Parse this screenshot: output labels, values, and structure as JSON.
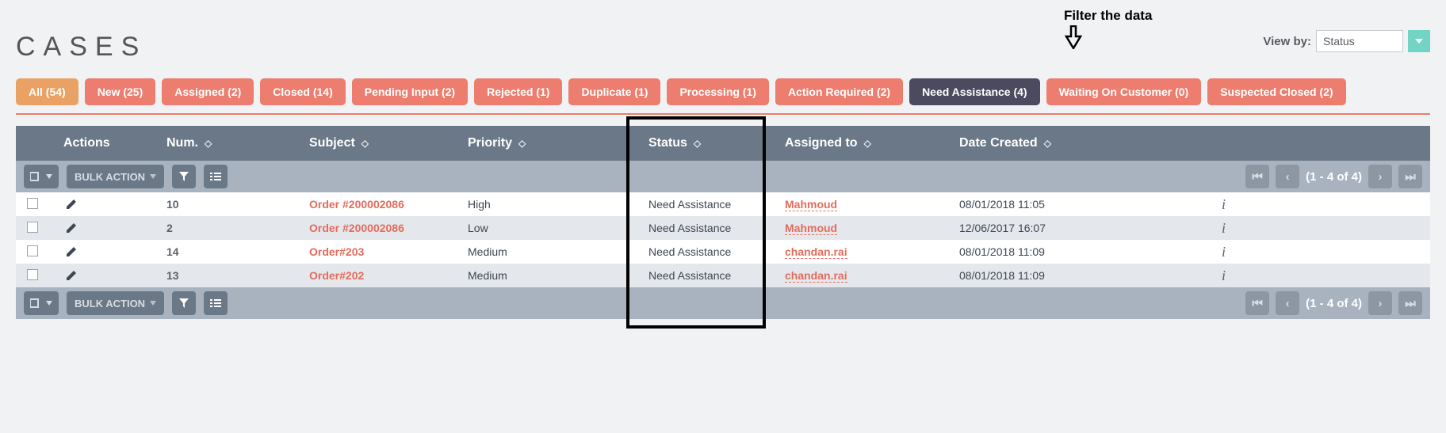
{
  "annotation": "Filter the data",
  "title": "CASES",
  "viewby": {
    "label": "View by:",
    "value": "Status"
  },
  "filters": [
    {
      "label": "All (54)",
      "style": "orange"
    },
    {
      "label": "New (25)",
      "style": ""
    },
    {
      "label": "Assigned (2)",
      "style": ""
    },
    {
      "label": "Closed (14)",
      "style": ""
    },
    {
      "label": "Pending Input (2)",
      "style": ""
    },
    {
      "label": "Rejected (1)",
      "style": ""
    },
    {
      "label": "Duplicate (1)",
      "style": ""
    },
    {
      "label": "Processing (1)",
      "style": ""
    },
    {
      "label": "Action Required (2)",
      "style": ""
    },
    {
      "label": "Need Assistance (4)",
      "style": "dark"
    },
    {
      "label": "Waiting On Customer (0)",
      "style": ""
    },
    {
      "label": "Suspected Closed (2)",
      "style": ""
    }
  ],
  "columns": {
    "actions": "Actions",
    "num": "Num.",
    "subject": "Subject",
    "priority": "Priority",
    "status": "Status",
    "assigned": "Assigned to",
    "date": "Date Created"
  },
  "bulk": "BULK ACTION",
  "pagination": "(1 - 4 of 4)",
  "rows": [
    {
      "num": "10",
      "subject": "Order #200002086",
      "priority": "High",
      "status": "Need Assistance",
      "assigned": "Mahmoud",
      "date": "08/01/2018 11:05"
    },
    {
      "num": "2",
      "subject": "Order #200002086",
      "priority": "Low",
      "status": "Need Assistance",
      "assigned": "Mahmoud",
      "date": "12/06/2017 16:07"
    },
    {
      "num": "14",
      "subject": "Order#203",
      "priority": "Medium",
      "status": "Need Assistance",
      "assigned": "chandan.rai",
      "date": "08/01/2018 11:09"
    },
    {
      "num": "13",
      "subject": "Order#202",
      "priority": "Medium",
      "status": "Need Assistance",
      "assigned": "chandan.rai",
      "date": "08/01/2018 11:09"
    }
  ]
}
